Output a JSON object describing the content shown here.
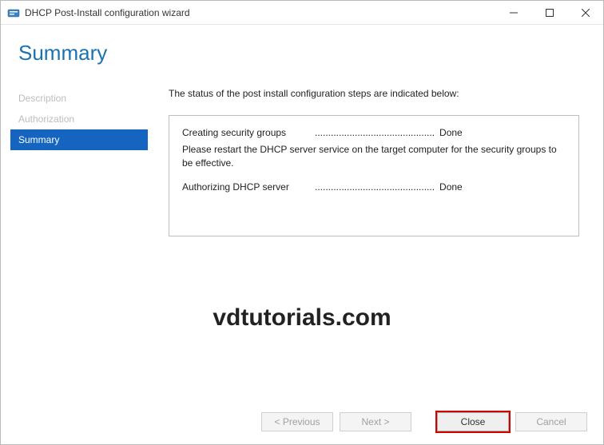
{
  "window": {
    "title": "DHCP Post-Install configuration wizard"
  },
  "header": {
    "title": "Summary"
  },
  "sidebar": {
    "items": [
      {
        "label": "Description",
        "active": false
      },
      {
        "label": "Authorization",
        "active": false
      },
      {
        "label": "Summary",
        "active": true
      }
    ]
  },
  "main": {
    "status_text": "The status of the post install configuration steps are indicated below:",
    "results": [
      {
        "label": "Creating security groups",
        "dots": ".............................................",
        "status": "Done"
      }
    ],
    "note": "Please restart the DHCP server service on the target computer for the security groups to be effective.",
    "results2": [
      {
        "label": "Authorizing DHCP server",
        "dots": ".............................................",
        "status": "Done"
      }
    ]
  },
  "footer": {
    "previous": "< Previous",
    "next": "Next >",
    "close": "Close",
    "cancel": "Cancel"
  },
  "watermark": "vdtutorials.com"
}
